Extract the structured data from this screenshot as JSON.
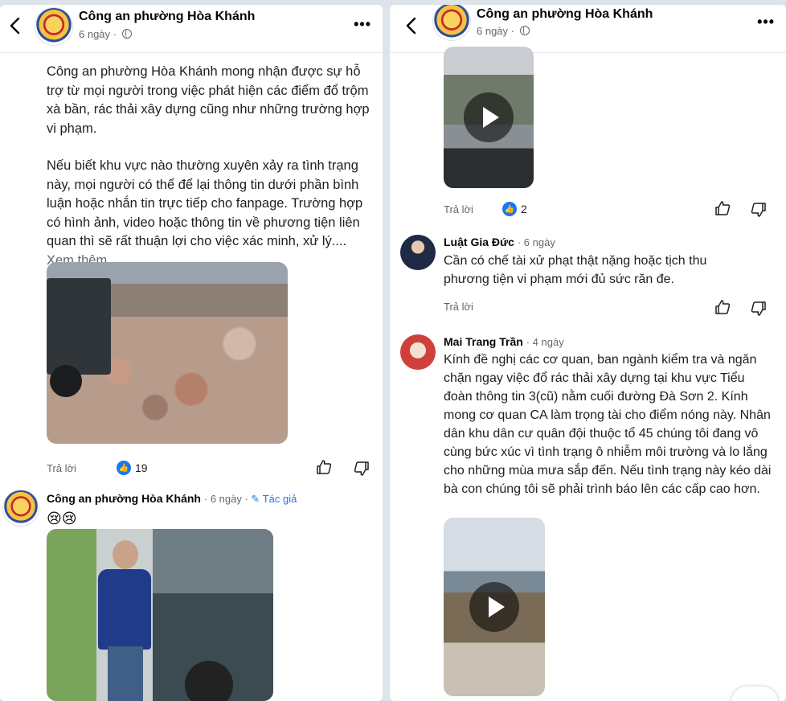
{
  "left": {
    "header": {
      "name": "Công an phường Hòa Khánh",
      "time": "6 ngày"
    },
    "post": {
      "para1": "Công an phường Hòa Khánh mong nhận được sự hỗ trợ từ mọi người trong việc phát hiện các điểm đổ trộm xà bần, rác thải xây dựng cũng như những trường hợp vi phạm.",
      "para2": "Nếu biết khu vực nào thường xuyên xảy ra tình trạng này, mọi người có thể để lại thông tin dưới phần bình luận hoặc nhắn tin trực tiếp cho fanpage. Trường hợp có hình ảnh, video hoặc thông tin về phương tiện liên quan thì sẽ rất thuận lợi cho việc xác minh, xử lý....",
      "see_more": "Xem thêm"
    },
    "actions": {
      "reply": "Trả lời",
      "likes": "19"
    },
    "comment": {
      "name": "Công an phường Hòa Khánh",
      "time": "6 ngày",
      "author_tag": "Tác giả",
      "emoji": "😢😢"
    }
  },
  "right": {
    "header": {
      "name": "Công an phường Hòa Khánh",
      "time": "6 ngày"
    },
    "actions1": {
      "reply": "Trả lời",
      "likes": "2"
    },
    "comments": [
      {
        "name": "Luật Gia Đức",
        "time": "6 ngày",
        "text": "Cần có chế tài xử phạt thật nặng hoặc tịch thu phương tiện vi phạm mới đủ sức răn đe.",
        "reply": "Trả lời"
      },
      {
        "name": "Mai Trang Trần",
        "time": "4 ngày",
        "text": "Kính đề nghị các cơ quan, ban ngành kiểm tra và ngăn chặn ngay việc đổ rác thải xây dựng tại khu vực Tiểu đoàn thông tin 3(cũ) nằm cuối đường Đà Sơn 2. Kính mong cơ quan CA làm trọng tài cho điểm nóng này. Nhân dân khu dân cư quân đội thuộc tổ 45 chúng tôi đang vô cùng bức xúc vì tình trạng ô nhiễm  môi trường và lo lắng cho những mùa mưa sắp đến. Nếu tình trạng này kéo dài bà con chúng tôi sẽ phải trình báo lên các cấp cao hơn."
      }
    ]
  }
}
